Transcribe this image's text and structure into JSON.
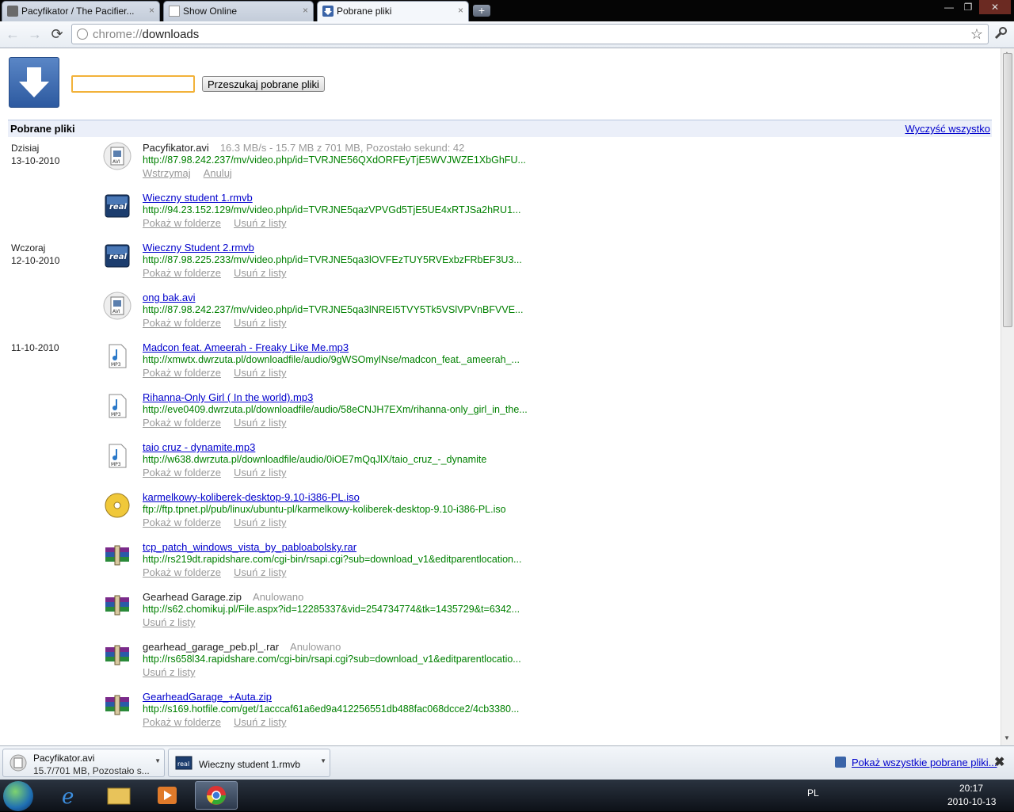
{
  "tabs": [
    {
      "title": "Pacyfikator / The Pacifier...",
      "close": "×"
    },
    {
      "title": "Show Online",
      "close": "×"
    },
    {
      "title": "Pobrane pliki",
      "close": "×"
    }
  ],
  "new_tab_glyph": "+",
  "window_controls": {
    "minimize": "—",
    "maximize": "❐",
    "close": "✕"
  },
  "toolbar": {
    "back": "←",
    "forward": "→",
    "reload": "⟳",
    "url_scheme": "chrome://",
    "url_host": "downloads",
    "star": "☆",
    "wrench": "🔧"
  },
  "search": {
    "value": "",
    "button_label": "Przeszukaj pobrane pliki"
  },
  "header": {
    "title": "Pobrane pliki",
    "clear_all": "Wyczyść wszystko"
  },
  "day_labels": [
    {
      "label": "Dzisiaj",
      "date": "13-10-2010"
    },
    {
      "label": "Wczoraj",
      "date": "12-10-2010"
    },
    {
      "label": "",
      "date": "11-10-2010"
    }
  ],
  "downloads": [
    {
      "name": "Pacyfikator.avi",
      "link": false,
      "status": "16.3 MB/s - 15.7 MB z 701 MB, Pozostało sekund: 42",
      "url": "http://87.98.242.237/mv/video.php/id=TVRJNE56QXdORFEyTjE5WVJWZE1XbGhFU...",
      "actions": [
        "Wstrzymaj",
        "Anuluj"
      ],
      "icon": "avi-icon"
    },
    {
      "name": "Wieczny student 1.rmvb",
      "link": true,
      "status": "",
      "url": "http://94.23.152.129/mv/video.php/id=TVRJNE5qazVPVGd5TjE5UE4xRTJSa2hRU1...",
      "actions": [
        "Pokaż w folderze",
        "Usuń z listy"
      ],
      "icon": "real-icon"
    },
    {
      "name": "Wieczny Student 2.rmvb",
      "link": true,
      "status": "",
      "url": "http://87.98.225.233/mv/video.php/id=TVRJNE5qa3lOVFEzTUY5RVExbzFRbEF3U3...",
      "actions": [
        "Pokaż w folderze",
        "Usuń z listy"
      ],
      "icon": "real-icon"
    },
    {
      "name": "ong bak.avi",
      "link": true,
      "status": "",
      "url": "http://87.98.242.237/mv/video.php/id=TVRJNE5qa3lNREI5TVY5Tk5VSlVPVnBFVVE...",
      "actions": [
        "Pokaż w folderze",
        "Usuń z listy"
      ],
      "icon": "avi-icon"
    },
    {
      "name": "Madcon feat. Ameerah - Freaky Like Me.mp3",
      "link": true,
      "status": "",
      "url": "http://xmwtx.dwrzuta.pl/downloadfile/audio/9gWSOmylNse/madcon_feat._ameerah_...",
      "actions": [
        "Pokaż w folderze",
        "Usuń z listy"
      ],
      "icon": "mp3-icon"
    },
    {
      "name": "Rihanna-Only Girl ( In the world).mp3",
      "link": true,
      "status": "",
      "url": "http://eve0409.dwrzuta.pl/downloadfile/audio/58eCNJH7EXm/rihanna-only_girl_in_the...",
      "actions": [
        "Pokaż w folderze",
        "Usuń z listy"
      ],
      "icon": "mp3-icon"
    },
    {
      "name": "taio cruz - dynamite.mp3",
      "link": true,
      "status": "",
      "url": "http://w638.dwrzuta.pl/downloadfile/audio/0iOE7mQqJlX/taio_cruz_-_dynamite",
      "actions": [
        "Pokaż w folderze",
        "Usuń z listy"
      ],
      "icon": "mp3-icon"
    },
    {
      "name": "karmelkowy-koliberek-desktop-9.10-i386-PL.iso",
      "link": true,
      "status": "",
      "url": "ftp://ftp.tpnet.pl/pub/linux/ubuntu-pl/karmelkowy-koliberek-desktop-9.10-i386-PL.iso",
      "actions": [
        "Pokaż w folderze",
        "Usuń z listy"
      ],
      "icon": "disc-icon"
    },
    {
      "name": "tcp_patch_windows_vista_by_pabloabolsky.rar",
      "link": true,
      "status": "",
      "url": "http://rs219dt.rapidshare.com/cgi-bin/rsapi.cgi?sub=download_v1&editparentlocation...",
      "actions": [
        "Pokaż w folderze",
        "Usuń z listy"
      ],
      "icon": "rar-icon"
    },
    {
      "name": "Gearhead Garage.zip",
      "link": false,
      "status": "Anulowano",
      "url": "http://s62.chomikuj.pl/File.aspx?id=12285337&vid=254734774&tk=1435729&t=6342...",
      "actions": [
        "Usuń z listy"
      ],
      "icon": "rar-icon"
    },
    {
      "name": "gearhead_garage_peb.pl_.rar",
      "link": false,
      "status": "Anulowano",
      "url": "http://rs658l34.rapidshare.com/cgi-bin/rsapi.cgi?sub=download_v1&editparentlocatio...",
      "actions": [
        "Usuń z listy"
      ],
      "icon": "rar-icon"
    },
    {
      "name": "GearheadGarage_+Auta.zip",
      "link": true,
      "status": "",
      "url": "http://s169.hotfile.com/get/1acccaf61a6ed9a412256551db488fac068dcce2/4cb3380...",
      "actions": [
        "Pokaż w folderze",
        "Usuń z listy"
      ],
      "icon": "rar-icon"
    }
  ],
  "shelf": {
    "items": [
      {
        "name": "Pacyfikator.avi",
        "sub": "15.7/701 MB, Pozostało s..."
      },
      {
        "name": "Wieczny student 1.rmvb",
        "sub": ""
      }
    ],
    "show_all": "Pokaż wszystkie pobrane pliki...",
    "close": "✖"
  },
  "taskbar": {
    "lang": "PL",
    "time": "20:17",
    "date": "2010-10-13"
  }
}
